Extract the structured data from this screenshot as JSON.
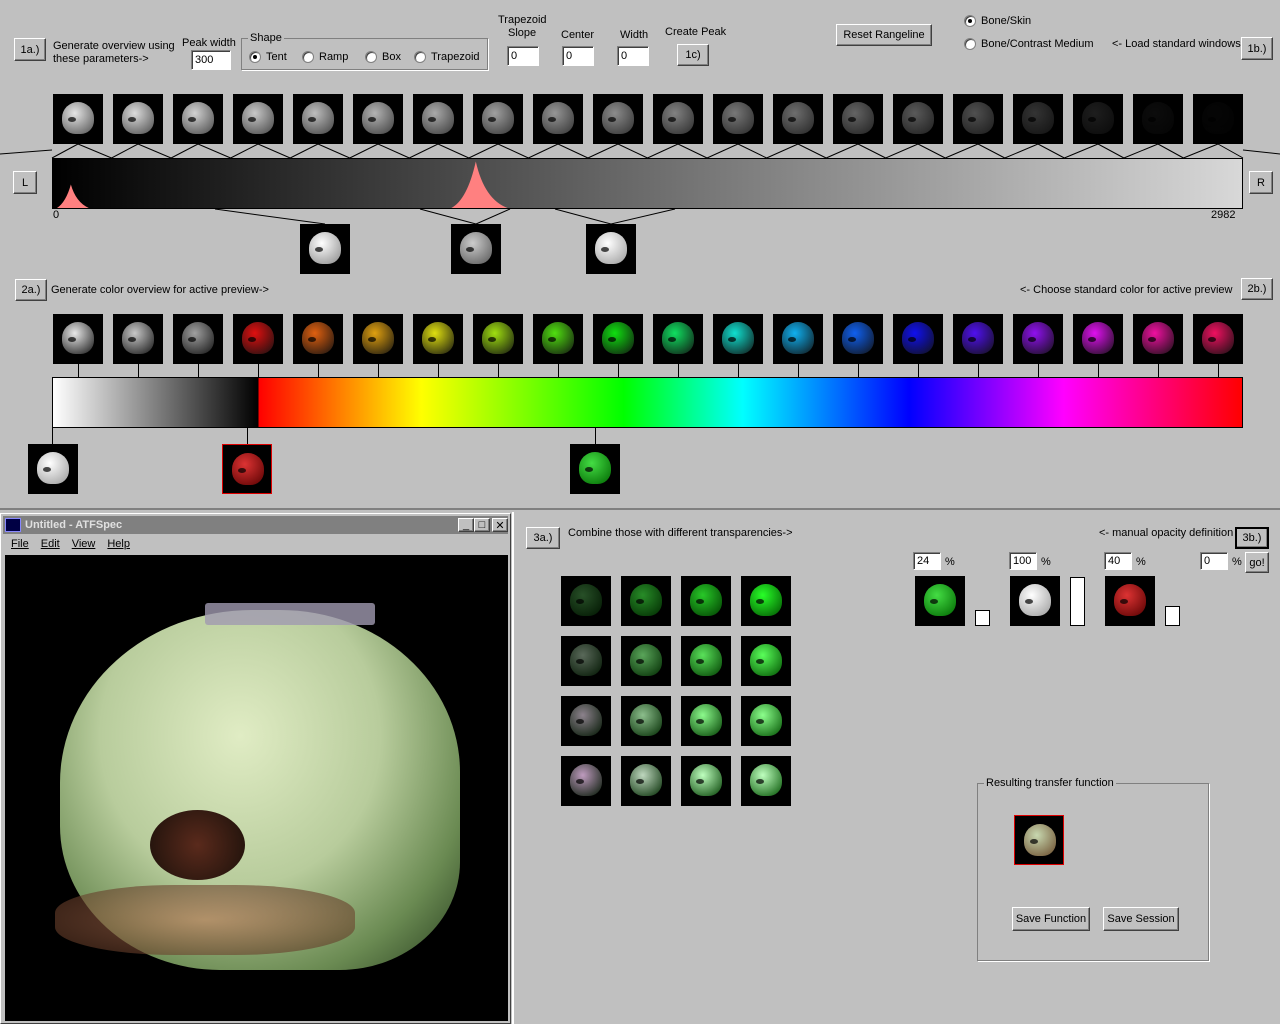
{
  "step1": {
    "btn_1a": "1a.)",
    "gen_line1": "Generate overview using",
    "gen_line2": "these parameters->",
    "peak_width_label": "Peak width",
    "peak_width_value": "300",
    "shape_label": "Shape",
    "shapes": [
      "Tent",
      "Ramp",
      "Box",
      "Trapezoid"
    ],
    "shape_selected": "Tent",
    "trap_slope_l1": "Trapezoid",
    "trap_slope_l2": "Slope",
    "trap_slope_value": "0",
    "center_label": "Center",
    "center_value": "0",
    "width_label": "Width",
    "width_value": "0",
    "create_peak_label": "Create Peak",
    "btn_1c": "1c)",
    "reset_rangeline": "Reset Rangeline",
    "windows": [
      "Bone/Skin",
      "Bone/Contrast Medium"
    ],
    "window_selected": "Bone/Skin",
    "load_std_windows": "<- Load standard windows",
    "btn_1b": "1b.)",
    "btn_L": "L",
    "btn_R": "R",
    "range_min": "0",
    "range_max": "2982",
    "histogram_peaks": [
      {
        "position": 0.015,
        "height": 0.5
      },
      {
        "position": 0.355,
        "height": 0.95
      }
    ]
  },
  "step2": {
    "btn_2a": "2a.)",
    "gen_color_label": "Generate color overview for active preview->",
    "choose_color_label": "<- Choose standard color for active preview",
    "btn_2b": "2b.)",
    "colors": [
      "#e8e8e8",
      "#c8c8c8",
      "#a0a0a0",
      "#e01010",
      "#e06010",
      "#e0a010",
      "#e0e010",
      "#a0e010",
      "#50e010",
      "#10e010",
      "#10e060",
      "#10e0d0",
      "#10b0f0",
      "#1060f0",
      "#1010f0",
      "#5010f0",
      "#9010f0",
      "#e010f0",
      "#f010a0",
      "#f01060"
    ],
    "selected_colors": [
      "#e8e8e8",
      "#d01010",
      "#10c010"
    ]
  },
  "viewer": {
    "title": "Untitled - ATFSpec",
    "menu": [
      "File",
      "Edit",
      "View",
      "Help"
    ]
  },
  "step3": {
    "btn_3a": "3a.)",
    "combine_label": "Combine those with different transparencies->",
    "manual_label": "<- manual opacity definition",
    "btn_3b": "3b.)",
    "opacities": [
      "24",
      "100",
      "40",
      "0"
    ],
    "opacity_levels": [
      0.24,
      1.0,
      0.4,
      0
    ],
    "pct": "%",
    "go_label": "go!",
    "result_label": "Resulting transfer function",
    "save_function": "Save Function",
    "save_session": "Save Session"
  }
}
